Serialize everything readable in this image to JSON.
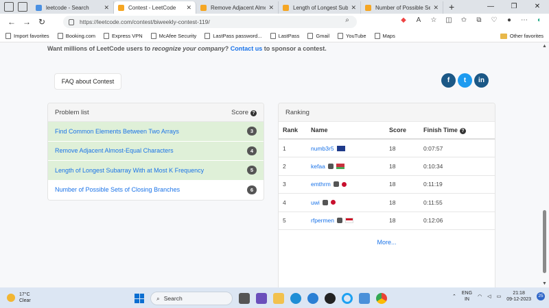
{
  "browser": {
    "tabs": [
      {
        "title": "leetcode - Search",
        "active": false
      },
      {
        "title": "Contest - LeetCode",
        "active": true
      },
      {
        "title": "Remove Adjacent Almos",
        "active": false
      },
      {
        "title": "Length of Longest Subar",
        "active": false
      },
      {
        "title": "Number of Possible Sets",
        "active": false
      }
    ],
    "url": "https://leetcode.com/contest/biweekly-contest-119/",
    "bookmarks": [
      "Import favorites",
      "Booking.com",
      "Express VPN",
      "McAfee Security",
      "LastPass password...",
      "LastPass",
      "Gmail",
      "YouTube",
      "Maps"
    ],
    "other_favorites": "Other favorites"
  },
  "sponsor": {
    "prefix": "Want millions of LeetCode users to ",
    "emphasis": "recognize your company",
    "mid": "? ",
    "link": "Contact us",
    "suffix": " to sponsor a contest."
  },
  "faq_label": "FAQ about Contest",
  "social": {
    "facebook": "f",
    "twitter": "t",
    "linkedin": "in"
  },
  "problem_list": {
    "title": "Problem list",
    "score_header": "Score",
    "problems": [
      {
        "name": "Find Common Elements Between Two Arrays",
        "score": "3",
        "solved": true
      },
      {
        "name": "Remove Adjacent Almost-Equal Characters",
        "score": "4",
        "solved": true
      },
      {
        "name": "Length of Longest Subarray With at Most K Frequency",
        "score": "5",
        "solved": true
      },
      {
        "name": "Number of Possible Sets of Closing Branches",
        "score": "6",
        "solved": false
      }
    ]
  },
  "ranking": {
    "title": "Ranking",
    "columns": {
      "rank": "Rank",
      "name": "Name",
      "score": "Score",
      "finish": "Finish Time"
    },
    "rows": [
      {
        "rank": "1",
        "name": "numb3r5",
        "score": "18",
        "finish": "0:07:57",
        "flag": "f-au",
        "badge": false
      },
      {
        "rank": "2",
        "name": "kefaa",
        "score": "18",
        "finish": "0:10:34",
        "flag": "f-by",
        "badge": true
      },
      {
        "rank": "3",
        "name": "emthrm",
        "score": "18",
        "finish": "0:11:19",
        "flag": "f-jp",
        "badge": true
      },
      {
        "rank": "4",
        "name": "uwi",
        "score": "18",
        "finish": "0:11:55",
        "flag": "f-jp",
        "badge": true
      },
      {
        "rank": "5",
        "name": "rfpermen",
        "score": "18",
        "finish": "0:12:06",
        "flag": "f-id",
        "badge": true
      }
    ],
    "more": "More..."
  },
  "taskbar": {
    "temp": "17°C",
    "weather": "Clear",
    "search": "Search",
    "lang1": "ENG",
    "lang2": "IN",
    "time": "21:18",
    "date": "09-12-2023",
    "notifications": "25"
  }
}
